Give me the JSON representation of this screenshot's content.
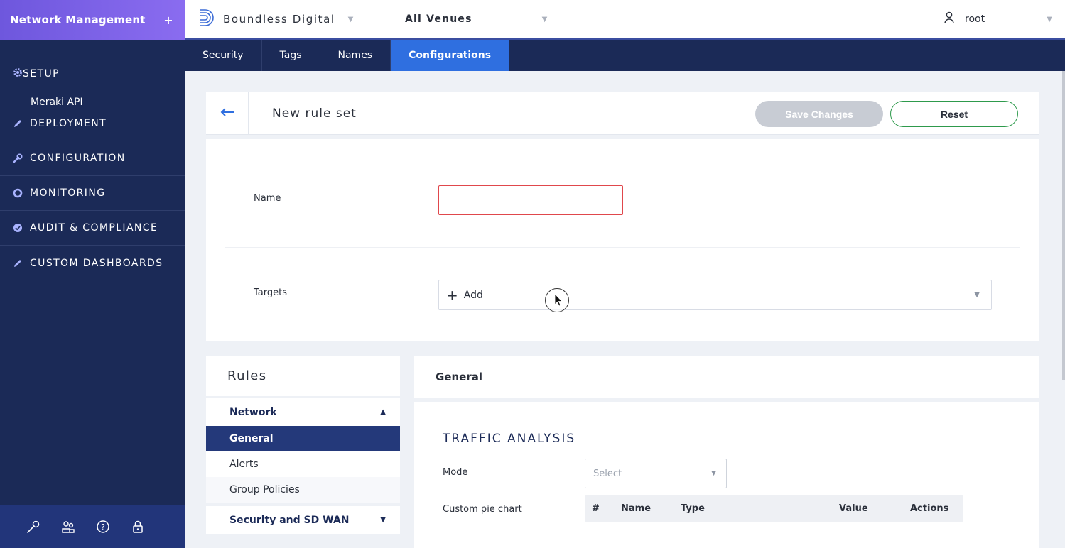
{
  "sidebar": {
    "title": "Network Management",
    "add_icon": "plus-icon",
    "setup": {
      "label": "SETUP",
      "icon": "gear-icon",
      "sub": "Meraki API"
    },
    "groups": [
      {
        "label": "DEPLOYMENT",
        "icon": "pencil-icon"
      },
      {
        "label": "CONFIGURATION",
        "icon": "wrench-icon"
      },
      {
        "label": "MONITORING",
        "icon": "monitoring-icon"
      },
      {
        "label": "AUDIT & COMPLIANCE",
        "icon": "check-badge-icon"
      },
      {
        "label": "CUSTOM DASHBOARDS",
        "icon": "pencil-icon"
      }
    ],
    "footer_icons": [
      "wrench-icon",
      "users-icon",
      "help-icon",
      "lock-icon"
    ]
  },
  "topbar": {
    "org": "Boundless Digital",
    "venue": "All Venues",
    "user": "root"
  },
  "tabs": [
    "Security",
    "Tags",
    "Names",
    "Configurations"
  ],
  "active_tab": "Configurations",
  "editor": {
    "title": "New rule set",
    "save_label": "Save Changes",
    "reset_label": "Reset",
    "name_label": "Name",
    "name_value": "",
    "targets_label": "Targets",
    "targets_add": "Add"
  },
  "rules": {
    "title": "Rules",
    "network": "Network",
    "items": [
      "General",
      "Alerts",
      "Group Policies"
    ],
    "active_item": "General",
    "security": "Security and SD WAN"
  },
  "general": {
    "title": "General",
    "section": "TRAFFIC ANALYSIS",
    "mode_label": "Mode",
    "mode_placeholder": "Select",
    "pie_label": "Custom pie chart",
    "columns": [
      "#",
      "Name",
      "Type",
      "Value",
      "Actions"
    ]
  },
  "colors": {
    "sidebar_bg": "#1b2a57",
    "header_gradient": "#7a60e6",
    "active_tab": "#2f6fe0",
    "reset_border": "#2e9a4c",
    "error_border": "#e0474c"
  }
}
